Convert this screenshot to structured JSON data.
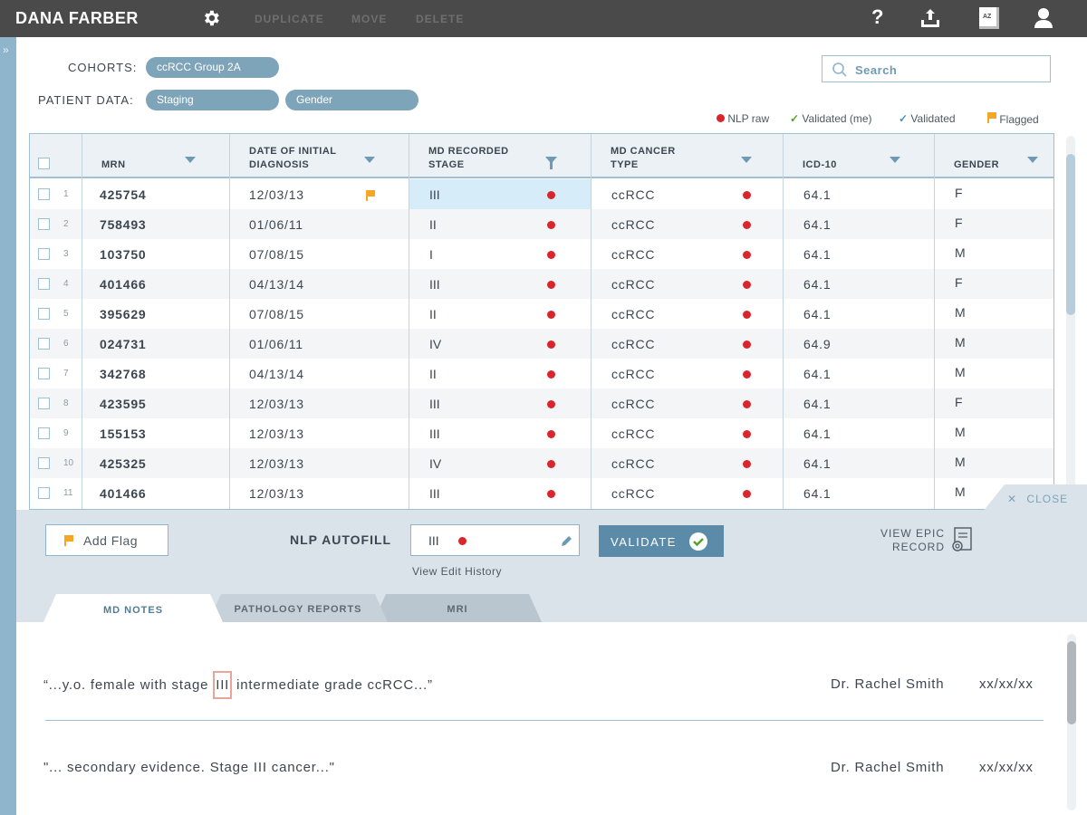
{
  "app": {
    "brand": "DANA FARBER"
  },
  "toolbar": {
    "duplicate": "DUPLICATE",
    "move": "MOVE",
    "delete": "DELETE",
    "help": "?",
    "sort_badge": "AZ"
  },
  "cohorts": {
    "label": "COHORTS:",
    "value": "ccRCC Group 2A"
  },
  "patient_data": {
    "label": "PATIENT DATA:",
    "chips": [
      "Staging",
      "Gender"
    ]
  },
  "search": {
    "placeholder": "Search"
  },
  "legend": {
    "nlp_raw": "NLP raw",
    "validated_me": "Validated (me)",
    "validated": "Validated",
    "flagged": "Flagged"
  },
  "table": {
    "columns": [
      "MRN",
      "DATE OF INITIAL DIAGNOSIS",
      "MD RECORDED STAGE",
      "MD CANCER TYPE",
      "ICD-10",
      "GENDER"
    ],
    "rows": [
      {
        "n": "1",
        "mrn": "425754",
        "date": "12/03/13",
        "stage": "III",
        "type": "ccRCC",
        "icd": "64.1",
        "gender": "F"
      },
      {
        "n": "2",
        "mrn": "758493",
        "date": "01/06/11",
        "stage": "II",
        "type": "ccRCC",
        "icd": "64.1",
        "gender": "F"
      },
      {
        "n": "3",
        "mrn": "103750",
        "date": "07/08/15",
        "stage": "I",
        "type": "ccRCC",
        "icd": "64.1",
        "gender": "M"
      },
      {
        "n": "4",
        "mrn": "401466",
        "date": "04/13/14",
        "stage": "III",
        "type": "ccRCC",
        "icd": "64.1",
        "gender": "F"
      },
      {
        "n": "5",
        "mrn": "395629",
        "date": "07/08/15",
        "stage": "II",
        "type": "ccRCC",
        "icd": "64.1",
        "gender": "M"
      },
      {
        "n": "6",
        "mrn": "024731",
        "date": "01/06/11",
        "stage": "IV",
        "type": "ccRCC",
        "icd": "64.9",
        "gender": "M"
      },
      {
        "n": "7",
        "mrn": "342768",
        "date": "04/13/14",
        "stage": "II",
        "type": "ccRCC",
        "icd": "64.1",
        "gender": "M"
      },
      {
        "n": "8",
        "mrn": "423595",
        "date": "12/03/13",
        "stage": "III",
        "type": "ccRCC",
        "icd": "64.1",
        "gender": "F"
      },
      {
        "n": "9",
        "mrn": "155153",
        "date": "12/03/13",
        "stage": "III",
        "type": "ccRCC",
        "icd": "64.1",
        "gender": "M"
      },
      {
        "n": "10",
        "mrn": "425325",
        "date": "12/03/13",
        "stage": "IV",
        "type": "ccRCC",
        "icd": "64.1",
        "gender": "M"
      },
      {
        "n": "11",
        "mrn": "401466",
        "date": "12/03/13",
        "stage": "III",
        "type": "ccRCC",
        "icd": "64.1",
        "gender": "M"
      }
    ]
  },
  "panel": {
    "close": "CLOSE",
    "add_flag": "Add Flag",
    "nlp_label": "NLP AUTOFILL",
    "nlp_value": "III",
    "validate": "VALIDATE",
    "edit_history": "View Edit History",
    "epic_line1": "VIEW EPIC",
    "epic_line2": "RECORD"
  },
  "tabs": [
    "MD NOTES",
    "PATHOLOGY REPORTS",
    "MRI"
  ],
  "notes": [
    {
      "pre": "“...y.o. female with stage ",
      "hl": "III",
      "post": " intermediate grade ccRCC...”",
      "author": "Dr. Rachel Smith",
      "date": "xx/xx/xx"
    },
    {
      "text": "\"... secondary evidence. Stage III cancer...\"",
      "author": "Dr. Rachel Smith",
      "date": "xx/xx/xx"
    }
  ],
  "colors": {
    "accent": "#7ea4ba",
    "nlp_red": "#d8262c",
    "flag_orange": "#f5a623",
    "check_green": "#5aa02c",
    "topbar": "#4a4a4a"
  }
}
